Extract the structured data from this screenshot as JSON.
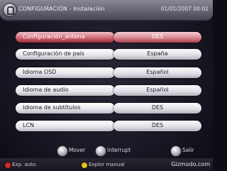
{
  "header": {
    "title": "CONFIGURACIÓN - Instalación",
    "date": "01/01/2007 00:01",
    "icon": "lock-icon"
  },
  "menu": {
    "items": [
      {
        "label": "Configuración_antena",
        "value": "DES",
        "selected": true
      },
      {
        "label": "Configuración de país",
        "value": "España",
        "selected": false
      },
      {
        "label": "Idioma OSD",
        "value": "Español",
        "selected": false
      },
      {
        "label": "Idioma de audio",
        "value": "Español",
        "selected": false
      },
      {
        "label": "Idioma de subtítulos",
        "value": "DES",
        "selected": false
      },
      {
        "label": "LCN",
        "value": "DES",
        "selected": false
      }
    ]
  },
  "hints": {
    "move": "Mover",
    "interrupt": "Interrupt",
    "exit": "Salir"
  },
  "keys": {
    "red": {
      "label": "Exp. auto.",
      "color": "#d42a2a"
    },
    "yellow": {
      "label": "Explor manual",
      "color": "#e2c21e"
    }
  },
  "watermark": "Gizmodo.com"
}
